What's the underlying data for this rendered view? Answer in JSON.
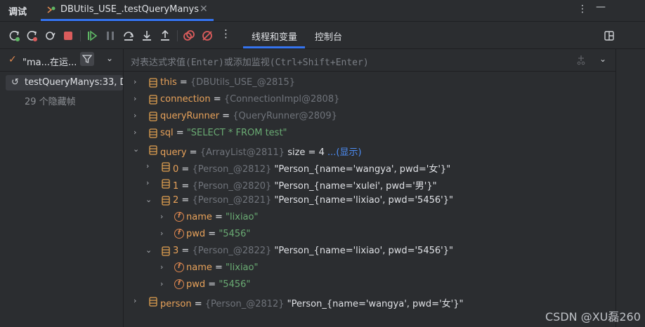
{
  "window": {
    "panel_title": "调试",
    "tab_label": "DBUtils_USE_.testQueryManys",
    "tab_close": "✕",
    "more_icon": "more-vertical-icon",
    "minimize_icon": "minimize-icon"
  },
  "toolbar": {
    "icons": [
      "rerun-icon",
      "rerun-failed-icon",
      "restart-icon",
      "stop-icon",
      "resume-icon",
      "pause-icon",
      "step-over-icon",
      "step-into-icon",
      "step-out-icon",
      "view-breakpoints-icon",
      "mute-breakpoints-icon",
      "more-icon"
    ],
    "tab_threads": "线程和变量",
    "tab_console": "控制台",
    "layout_icon": "layout-icon"
  },
  "threads": {
    "selected": "\"ma...在运...",
    "filter_icon": "filter-icon"
  },
  "frames": {
    "current": "testQueryManys:33, D",
    "hidden": "29 个隐藏帧"
  },
  "evaluate": {
    "placeholder": "对表达式求值(Enter)或添加监视(Ctrl+Shift+Enter)"
  },
  "variables": [
    {
      "name": "this",
      "eq": " = ",
      "ref": "{DBUtils_USE_@2815}",
      "value": ""
    },
    {
      "name": "connection",
      "eq": " = ",
      "ref": "{ConnectionImpl@2808}",
      "value": ""
    },
    {
      "name": "queryRunner",
      "eq": " = ",
      "ref": "{QueryRunner@2809}",
      "value": ""
    },
    {
      "name": "sql",
      "eq": " = ",
      "ref": "",
      "value": "\"SELECT * FROM test\""
    },
    {
      "name": "query",
      "eq": " = ",
      "ref": "{ArrayList@2811}",
      "value": "  size = 4",
      "link": "...(显示)"
    },
    {
      "name": "0",
      "eq": " = ",
      "ref": "{Person_@2812}",
      "value": " \"Person_{name='wangya', pwd='女'}\""
    },
    {
      "name": "1",
      "eq": " = ",
      "ref": "{Person_@2820}",
      "value": " \"Person_{name='xulei', pwd='男'}\""
    },
    {
      "name": "2",
      "eq": " = ",
      "ref": "{Person_@2821}",
      "value": " \"Person_{name='lixiao', pwd='5456'}\""
    },
    {
      "name": "name",
      "eq": " = ",
      "ref": "",
      "value": "\"lixiao\""
    },
    {
      "name": "pwd",
      "eq": " = ",
      "ref": "",
      "value": "\"5456\""
    },
    {
      "name": "3",
      "eq": " = ",
      "ref": "{Person_@2822}",
      "value": " \"Person_{name='lixiao', pwd='5456'}\""
    },
    {
      "name": "name",
      "eq": " = ",
      "ref": "",
      "value": "\"lixiao\""
    },
    {
      "name": "pwd",
      "eq": " = ",
      "ref": "",
      "value": "\"5456\""
    },
    {
      "name": "person",
      "eq": " = ",
      "ref": "{Person_@2812}",
      "value": " \"Person_{name='wangya', pwd='女'}\""
    }
  ],
  "watermark": "CSDN @XU磊260",
  "colors": {
    "accent": "#3574f0",
    "var_name": "#e8a25a",
    "string": "#6aab73",
    "ref": "#6f737a",
    "link": "#4d8ef7"
  }
}
